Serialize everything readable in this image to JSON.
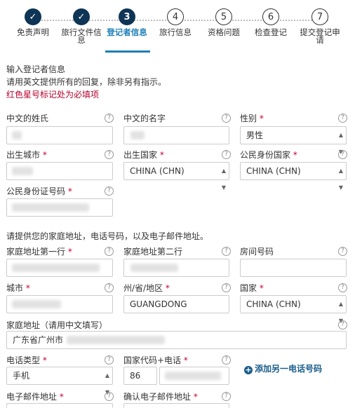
{
  "steps": [
    {
      "num": "✓",
      "label": "免责声明",
      "state": "done"
    },
    {
      "num": "✓",
      "label": "旅行文件信息",
      "state": "done"
    },
    {
      "num": "3",
      "label": "登记者信息",
      "state": "current"
    },
    {
      "num": "4",
      "label": "旅行信息",
      "state": "todo"
    },
    {
      "num": "5",
      "label": "资格问题",
      "state": "todo"
    },
    {
      "num": "6",
      "label": "检查登记",
      "state": "todo"
    },
    {
      "num": "7",
      "label": "提交登记申请",
      "state": "todo"
    }
  ],
  "intro": {
    "heading": "输入登记者信息",
    "line": "请用英文提供所有的回复，除非另有指示。",
    "required_note": "红色星号标记处为必填项"
  },
  "section2_note": "请提供您的家庭地址，电话号码，以及电子邮件地址。",
  "required_mark": "*",
  "help_glyph": "?",
  "fields": {
    "surname": {
      "label": "中文的姓氏",
      "value": ""
    },
    "given": {
      "label": "中文的名字",
      "value": ""
    },
    "gender": {
      "label": "性别",
      "value": "男性"
    },
    "birth_city": {
      "label": "出生城市",
      "value": ""
    },
    "birth_country": {
      "label": "出生国家",
      "value": "CHINA (CHN)"
    },
    "citizen_country": {
      "label": "公民身份国家",
      "value": "CHINA (CHN)"
    },
    "id_number": {
      "label": "公民身份证号码",
      "value": ""
    },
    "addr1": {
      "label": "家庭地址第一行",
      "value": ""
    },
    "addr2": {
      "label": "家庭地址第二行",
      "value": ""
    },
    "room": {
      "label": "房间号码",
      "value": ""
    },
    "city": {
      "label": "城市",
      "value": ""
    },
    "state": {
      "label": "州/省/地区",
      "value": "GUANGDONG"
    },
    "country": {
      "label": "国家",
      "value": "CHINA (CHN)"
    },
    "addr_cn": {
      "label": "家庭地址（请用中文填写）",
      "value": "广东省广州市"
    },
    "phone_type": {
      "label": "电话类型",
      "value": "手机"
    },
    "phone": {
      "label": "国家代码+电话",
      "code": "86",
      "value": ""
    },
    "email": {
      "label": "电子邮件地址",
      "value": ""
    },
    "email_confirm": {
      "label": "确认电子邮件地址",
      "value": ""
    }
  },
  "add_phone": "添加另一电话号码",
  "colors": {
    "primary": "#0e3555",
    "link": "#1b5e8c",
    "required": "#c4002d"
  }
}
